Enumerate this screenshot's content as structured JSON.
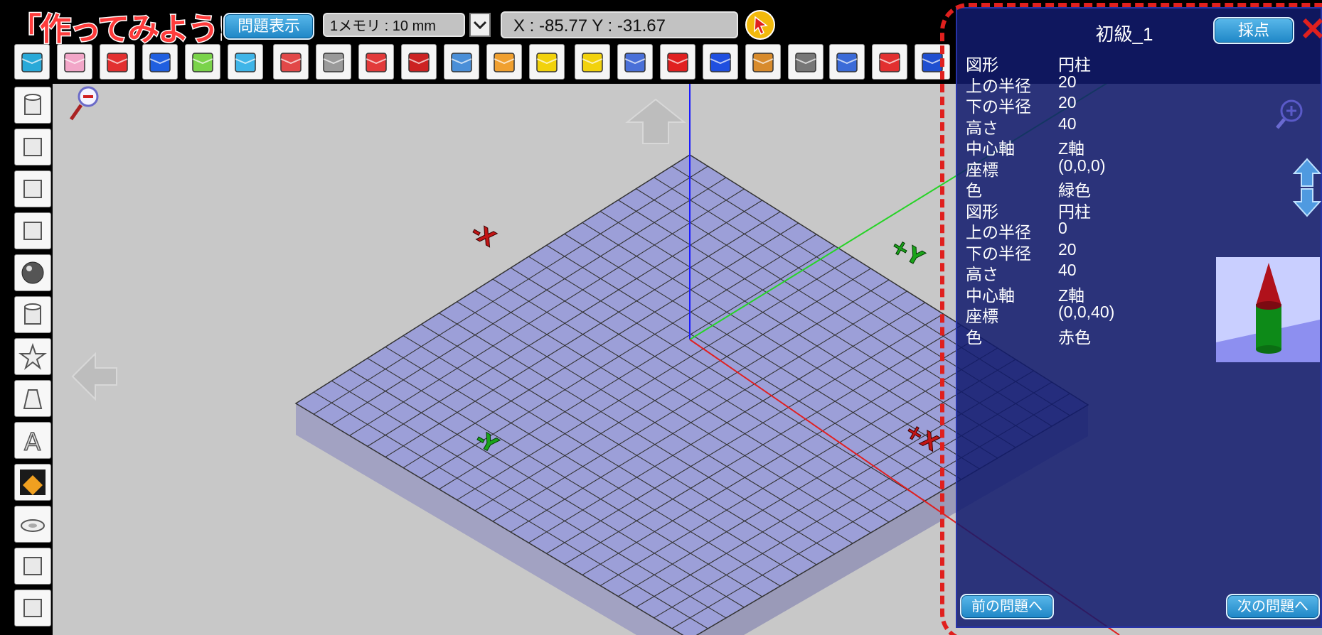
{
  "app": {
    "logo_text": "「作ってみよう!」",
    "problem_button": "問題表示",
    "scale_select": "1メモリ : 10 mm",
    "coords": "X : -85.77  Y : -31.67"
  },
  "toolbar": {
    "icons": [
      "cube-view-icon",
      "pink-cube-icon",
      "import-icon",
      "export-icon",
      "move-icon",
      "rotate-icon",
      "drop-icon",
      "extrude-icon",
      "fit-icon",
      "cut-icon",
      "comment-icon",
      "palette-icon",
      "measure-icon",
      "settings-icon",
      "book-icon",
      "arrow-left-icon",
      "arrow-right-icon",
      "brush-icon",
      "walk-icon",
      "camera-icon",
      "page-icon",
      "help-icon"
    ]
  },
  "sidebar": {
    "icons": [
      "cylinder-icon",
      "cube-icon",
      "box-icon",
      "wedge-icon",
      "sphere-icon",
      "tube-icon",
      "star-icon",
      "cone-icon",
      "text-icon",
      "texture-icon",
      "disk-icon",
      "block-icon",
      "stack-icon"
    ]
  },
  "axes": {
    "neg_x": "-X",
    "pos_x": "+X",
    "pos_y": "+Y",
    "neg_y": "-Y"
  },
  "panel": {
    "title": "初級_1",
    "grade_button": "採点",
    "prev_button": "前の問題へ",
    "next_button": "次の問題へ",
    "shapes": [
      {
        "rows": [
          {
            "key": "図形",
            "value": "円柱"
          },
          {
            "key": "上の半径",
            "value": "20"
          },
          {
            "key": "下の半径",
            "value": "20"
          },
          {
            "key": "高さ",
            "value": "40"
          },
          {
            "key": "中心軸",
            "value": "Z軸"
          },
          {
            "key": "座標",
            "value": "(0,0,0)"
          },
          {
            "key": "色",
            "value": "緑色"
          }
        ]
      },
      {
        "rows": [
          {
            "key": "図形",
            "value": "円柱"
          },
          {
            "key": "上の半径",
            "value": "0"
          },
          {
            "key": "下の半径",
            "value": "20"
          },
          {
            "key": "高さ",
            "value": "40"
          },
          {
            "key": "中心軸",
            "value": "Z軸"
          },
          {
            "key": "座標",
            "value": "(0,0,40)"
          },
          {
            "key": "色",
            "value": "赤色"
          }
        ]
      }
    ]
  },
  "colors": {
    "grid_fill": "#9c9fd8",
    "panel_bg": "#111b6e",
    "highlight": "#e0201e"
  }
}
